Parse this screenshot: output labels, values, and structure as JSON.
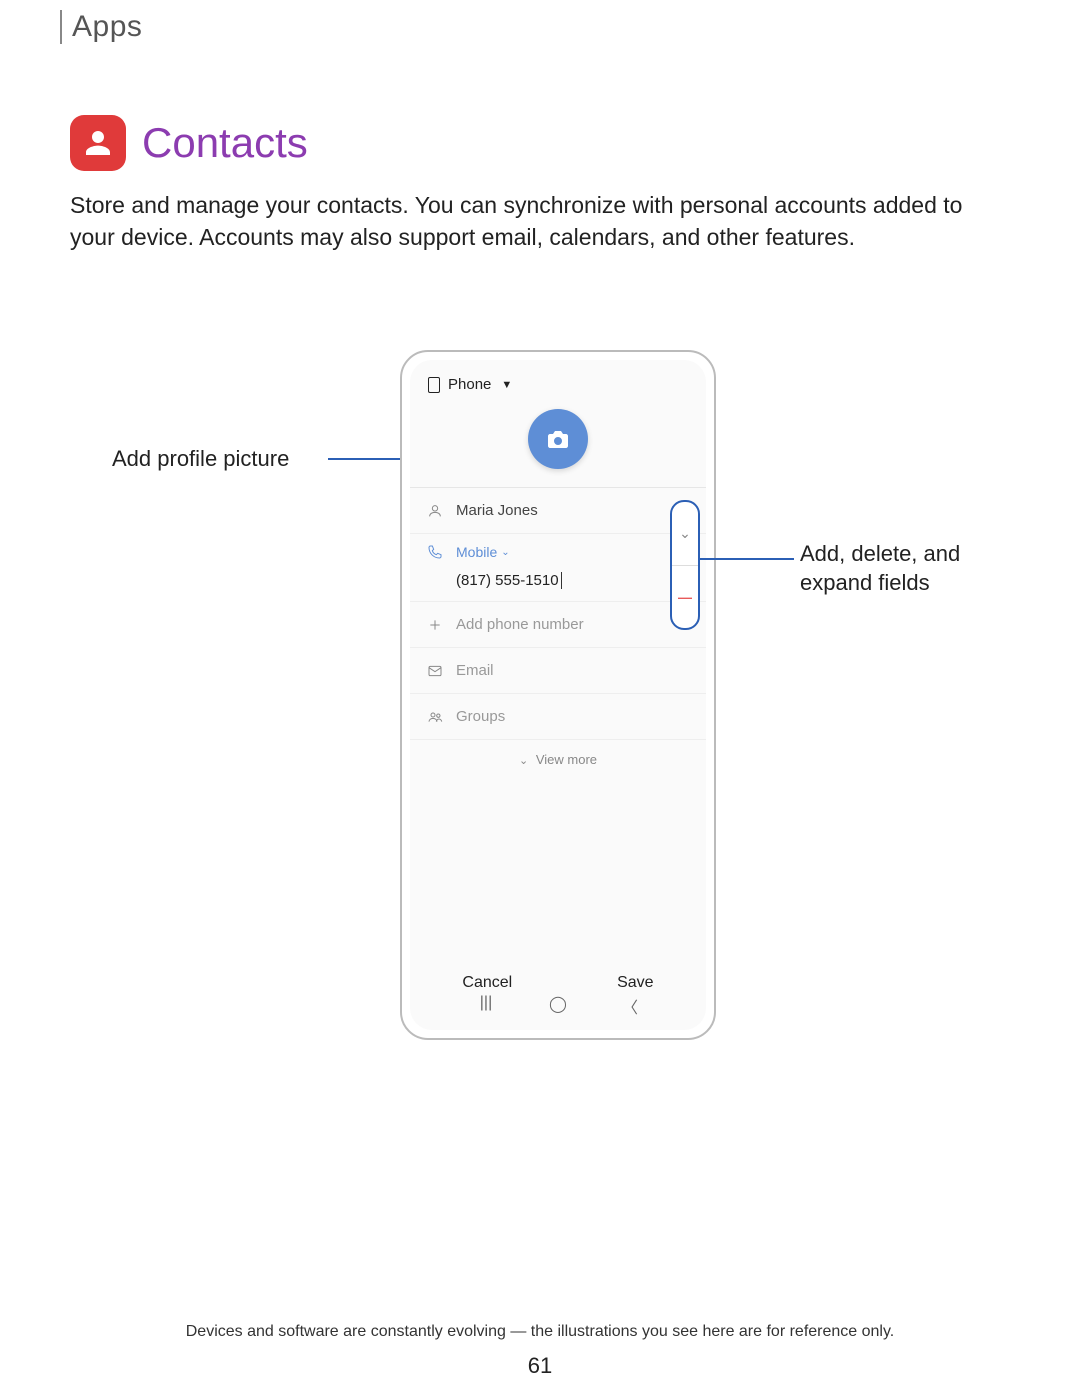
{
  "breadcrumb": "Apps",
  "title": "Contacts",
  "intro": "Store and manage your contacts. You can synchronize with personal accounts added to your device. Accounts may also support email, calendars, and other features.",
  "callouts": {
    "left": "Add profile picture",
    "right": "Add, delete, and expand fields"
  },
  "phone": {
    "storage_label": "Phone",
    "fields": {
      "name": "Maria Jones",
      "mobile_label": "Mobile",
      "number": "(817) 555-1510",
      "add_phone": "Add phone number",
      "email": "Email",
      "groups": "Groups",
      "view_more": "View more"
    },
    "buttons": {
      "cancel": "Cancel",
      "save": "Save"
    }
  },
  "disclaimer": "Devices and software are constantly evolving — the illustrations you see here are for reference only.",
  "page_number": "61"
}
